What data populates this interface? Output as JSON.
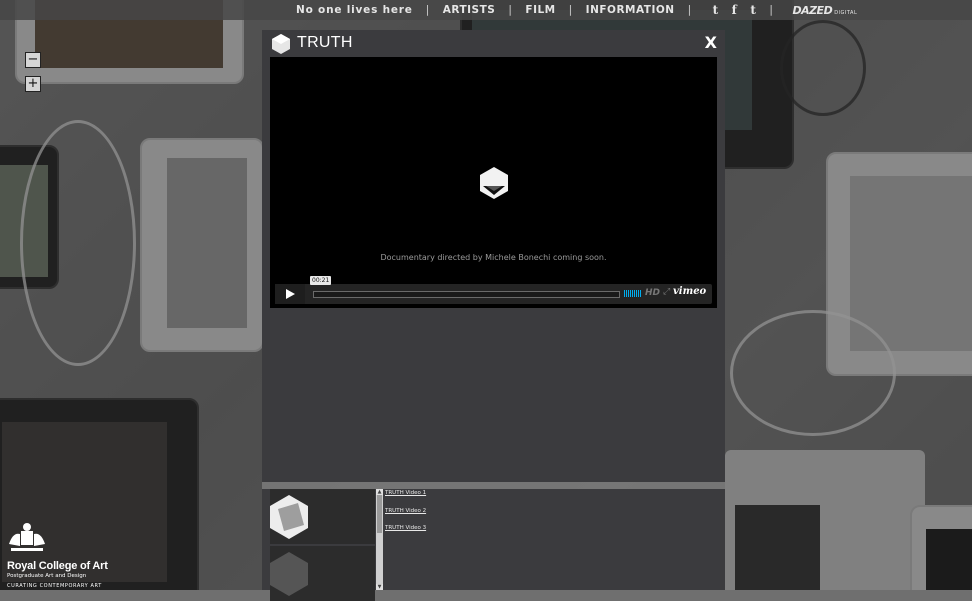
{
  "nav": {
    "items": [
      "No one lives here",
      "ARTISTS",
      "FILM",
      "INFORMATION"
    ],
    "separator": "|",
    "social_icons": [
      "twitter-icon",
      "facebook-icon",
      "tumblr-icon"
    ],
    "social_glyphs": [
      "t",
      "f",
      "t"
    ],
    "partner": "DAZED",
    "partner_sub": "DIGITAL"
  },
  "zoom": {
    "out": "−",
    "in": "+"
  },
  "modal": {
    "title": "TRUTH",
    "close": "X"
  },
  "player": {
    "caption": "Documentary directed by Michele Bonechi coming soon.",
    "time": "00:21",
    "hd": "HD",
    "fullscreen": "⤢",
    "brand": "vimeo"
  },
  "playlist": {
    "links": [
      "TRUTH Video 1",
      "TRUTH Video 2",
      "TRUTH Video 3"
    ]
  },
  "college": {
    "name": "Royal College of Art",
    "subtitle": "Postgraduate Art and Design",
    "tagline": "CURATING CONTEMPORARY ART"
  },
  "colors": {
    "accent": "#00adef",
    "modal_bg": "#3b3b3e"
  }
}
